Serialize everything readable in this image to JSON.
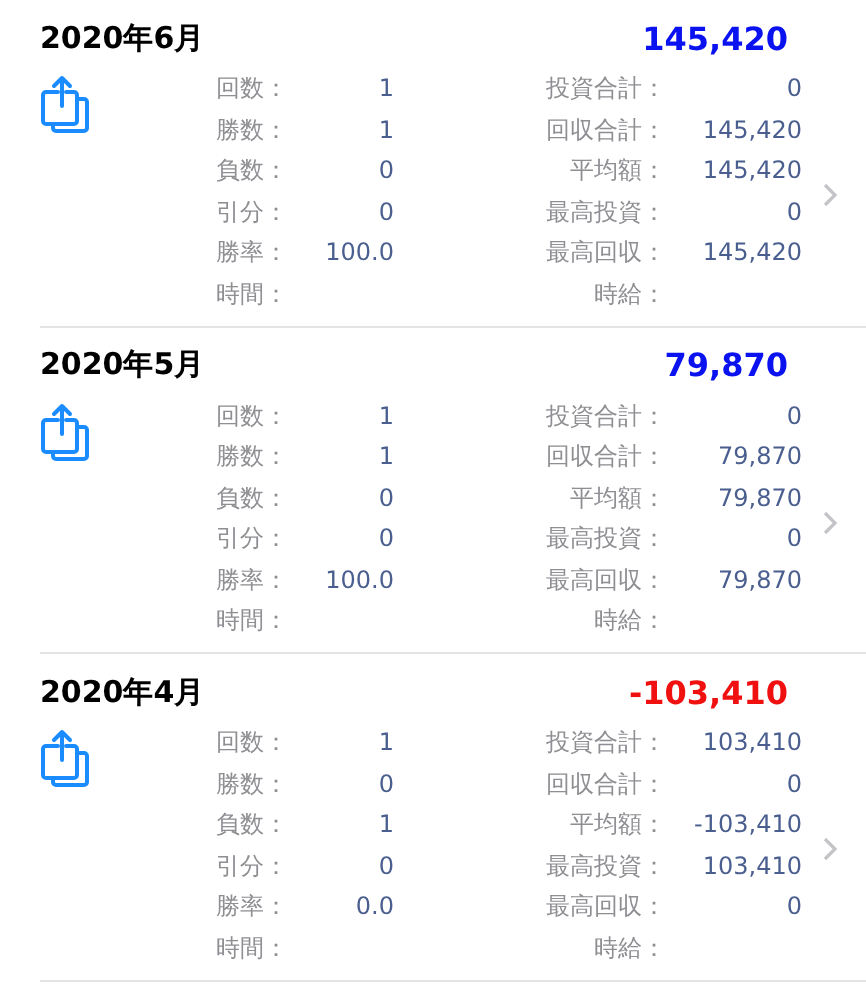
{
  "months": [
    {
      "title": "2020年6月",
      "total": "145,420",
      "kind": "gain",
      "left": [
        {
          "label": "回数：",
          "value": "1"
        },
        {
          "label": "勝数：",
          "value": "1"
        },
        {
          "label": "負数：",
          "value": "0"
        },
        {
          "label": "引分：",
          "value": "0"
        },
        {
          "label": "勝率：",
          "value": "100.0"
        },
        {
          "label": "時間："
        }
      ],
      "right": [
        {
          "label": "投資合計：",
          "value": "0"
        },
        {
          "label": "回収合計：",
          "value": "145,420"
        },
        {
          "label": "平均額：",
          "value": "145,420"
        },
        {
          "label": "最高投資：",
          "value": "0"
        },
        {
          "label": "最高回収：",
          "value": "145,420"
        },
        {
          "label": "時給："
        }
      ]
    },
    {
      "title": "2020年5月",
      "total": "79,870",
      "kind": "gain",
      "left": [
        {
          "label": "回数：",
          "value": "1"
        },
        {
          "label": "勝数：",
          "value": "1"
        },
        {
          "label": "負数：",
          "value": "0"
        },
        {
          "label": "引分：",
          "value": "0"
        },
        {
          "label": "勝率：",
          "value": "100.0"
        },
        {
          "label": "時間："
        }
      ],
      "right": [
        {
          "label": "投資合計：",
          "value": "0"
        },
        {
          "label": "回収合計：",
          "value": "79,870"
        },
        {
          "label": "平均額：",
          "value": "79,870"
        },
        {
          "label": "最高投資：",
          "value": "0"
        },
        {
          "label": "最高回収：",
          "value": "79,870"
        },
        {
          "label": "時給："
        }
      ]
    },
    {
      "title": "2020年4月",
      "total": "-103,410",
      "kind": "loss",
      "left": [
        {
          "label": "回数：",
          "value": "1"
        },
        {
          "label": "勝数：",
          "value": "0"
        },
        {
          "label": "負数：",
          "value": "1"
        },
        {
          "label": "引分：",
          "value": "0"
        },
        {
          "label": "勝率：",
          "value": "0.0"
        },
        {
          "label": "時間："
        }
      ],
      "right": [
        {
          "label": "投資合計：",
          "value": "103,410"
        },
        {
          "label": "回収合計：",
          "value": "0"
        },
        {
          "label": "平均額：",
          "value": "-103,410"
        },
        {
          "label": "最高投資：",
          "value": "103,410"
        },
        {
          "label": "最高回収：",
          "value": "0"
        },
        {
          "label": "時給："
        }
      ]
    }
  ]
}
